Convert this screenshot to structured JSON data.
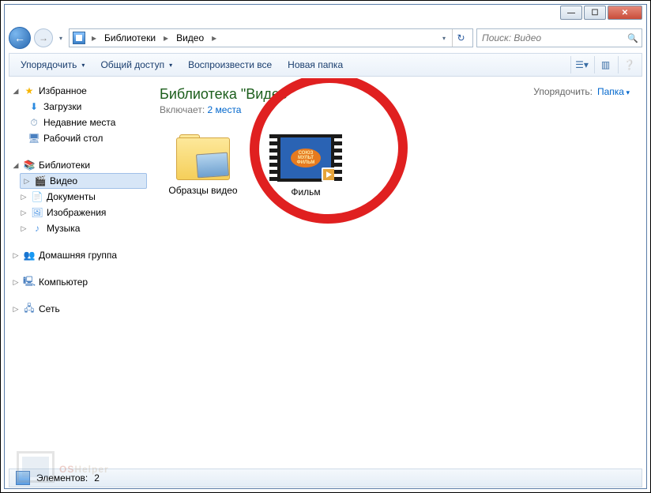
{
  "breadcrumb": {
    "root": "Библиотеки",
    "current": "Видео"
  },
  "search": {
    "placeholder": "Поиск: Видео"
  },
  "toolbar": {
    "organize": "Упорядочить",
    "share": "Общий доступ",
    "play_all": "Воспроизвести все",
    "new_folder": "Новая папка"
  },
  "library": {
    "title": "Библиотека \"Видео\"",
    "includes_label": "Включает:",
    "includes_link": "2 места",
    "arrange_label": "Упорядочить:",
    "arrange_value": "Папка"
  },
  "sidebar": {
    "favorites": "Избранное",
    "downloads": "Загрузки",
    "recent": "Недавние места",
    "desktop": "Рабочий стол",
    "libraries": "Библиотеки",
    "video": "Видео",
    "documents": "Документы",
    "images": "Изображения",
    "music": "Музыка",
    "homegroup": "Домашняя группа",
    "computer": "Компьютер",
    "network": "Сеть"
  },
  "items": {
    "folder1": "Образцы видео",
    "file1": "Фильм"
  },
  "status": {
    "elements_label": "Элементов:",
    "count": "2"
  },
  "watermark": {
    "t1": "OS",
    "t2": "Helper"
  }
}
